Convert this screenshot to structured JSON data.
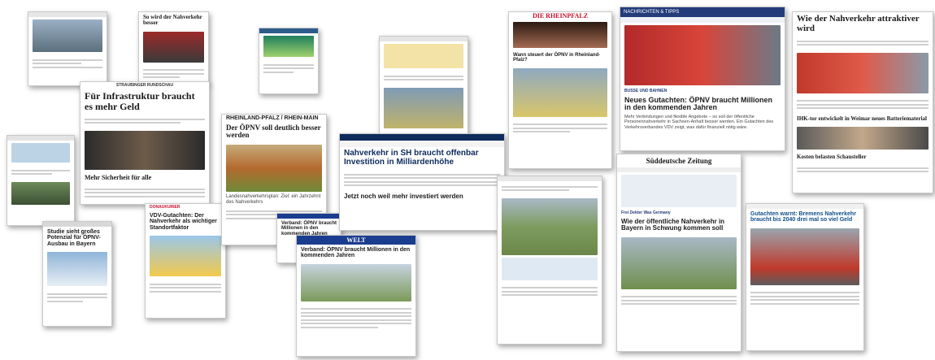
{
  "clippings": {
    "sz_print": {
      "mast": "Süddeutsche Zeitung",
      "headline": "So wird der Nahverkehr besser"
    },
    "straubinger": {
      "mast": "STRAUBINGER RUNDSCHAU",
      "headline": "Für Infrastruktur braucht es mehr Geld",
      "sub": "Mehr Sicherheit für alle"
    },
    "rheinpfalz_print": {
      "mast": "RHEINLAND-PFALZ / RHEIN-MAIN",
      "headline": "Der ÖPNV soll deutlich besser werden",
      "sub": "Landesnahverkehrsplan: Ziel: ein Jahrzehnt des Nahverkehrs"
    },
    "welt": {
      "mast": "WELT",
      "headline": "Verband: ÖPNV braucht Millionen in den kommenden Jahren"
    },
    "shz": {
      "headline": "Nahverkehr in SH braucht offenbar Investition in Milliardenhöhe",
      "sub": "Jetzt noch weil mehr investiert werden"
    },
    "rheinpfalz_web": {
      "mast": "DIE RHEINPFALZ",
      "headline": "Wann steuert der ÖPNV in Rheinland-Pfalz?"
    },
    "nachrichten": {
      "mast": "NACHRICHTEN & TIPPS",
      "kicker": "BUSSE UND BAHNEN",
      "headline": "Neues Gutachten: ÖPNV braucht Millionen in den kommenden Jahren",
      "body": "Mehr Verbindungen und flexible Angebote – so soll der öffentliche Personennahverkehr in Sachsen-Anhalt besser werden. Ein Gutachten des Verkehrsverbandes VDV zeigt, was dafür finanziell nötig wäre."
    },
    "weimar": {
      "headline": "Wie der Nahverkehr attraktiver wird",
      "sub": "IHK-tor entwickelt in Weimar neues Batteriematerial",
      "sub2": "Kosten belasten Schausteller"
    },
    "sz_web": {
      "mast": "Süddeutsche Zeitung",
      "promo": "Frei Dekter Was Germany",
      "headline": "Wie der öffentliche Nahverkehr in Bayern in Schwung kommen soll"
    },
    "bremen": {
      "headline": "Gutachten warnt: Bremens Nahverkehr braucht bis 2040 drei mal so viel Geld"
    },
    "pnp": {
      "headline": "Studie sieht großes Potenzial für ÖPNV-Ausbau in Bayern"
    },
    "donaukurier": {
      "mast": "DONAUKURIER",
      "headline": "VDV-Gutachten: Der Nahverkehr als wichtiger Standortfaktor"
    },
    "mdr": {
      "headline": "Verband: ÖPNV braucht Millionen in den kommenden Jahren"
    }
  },
  "colors": {
    "sz_blue": "#243c7a",
    "welt_blue": "#1a3d8f",
    "rheinpfalz_red": "#c8102e",
    "shz_blue": "#0e2b5c"
  }
}
